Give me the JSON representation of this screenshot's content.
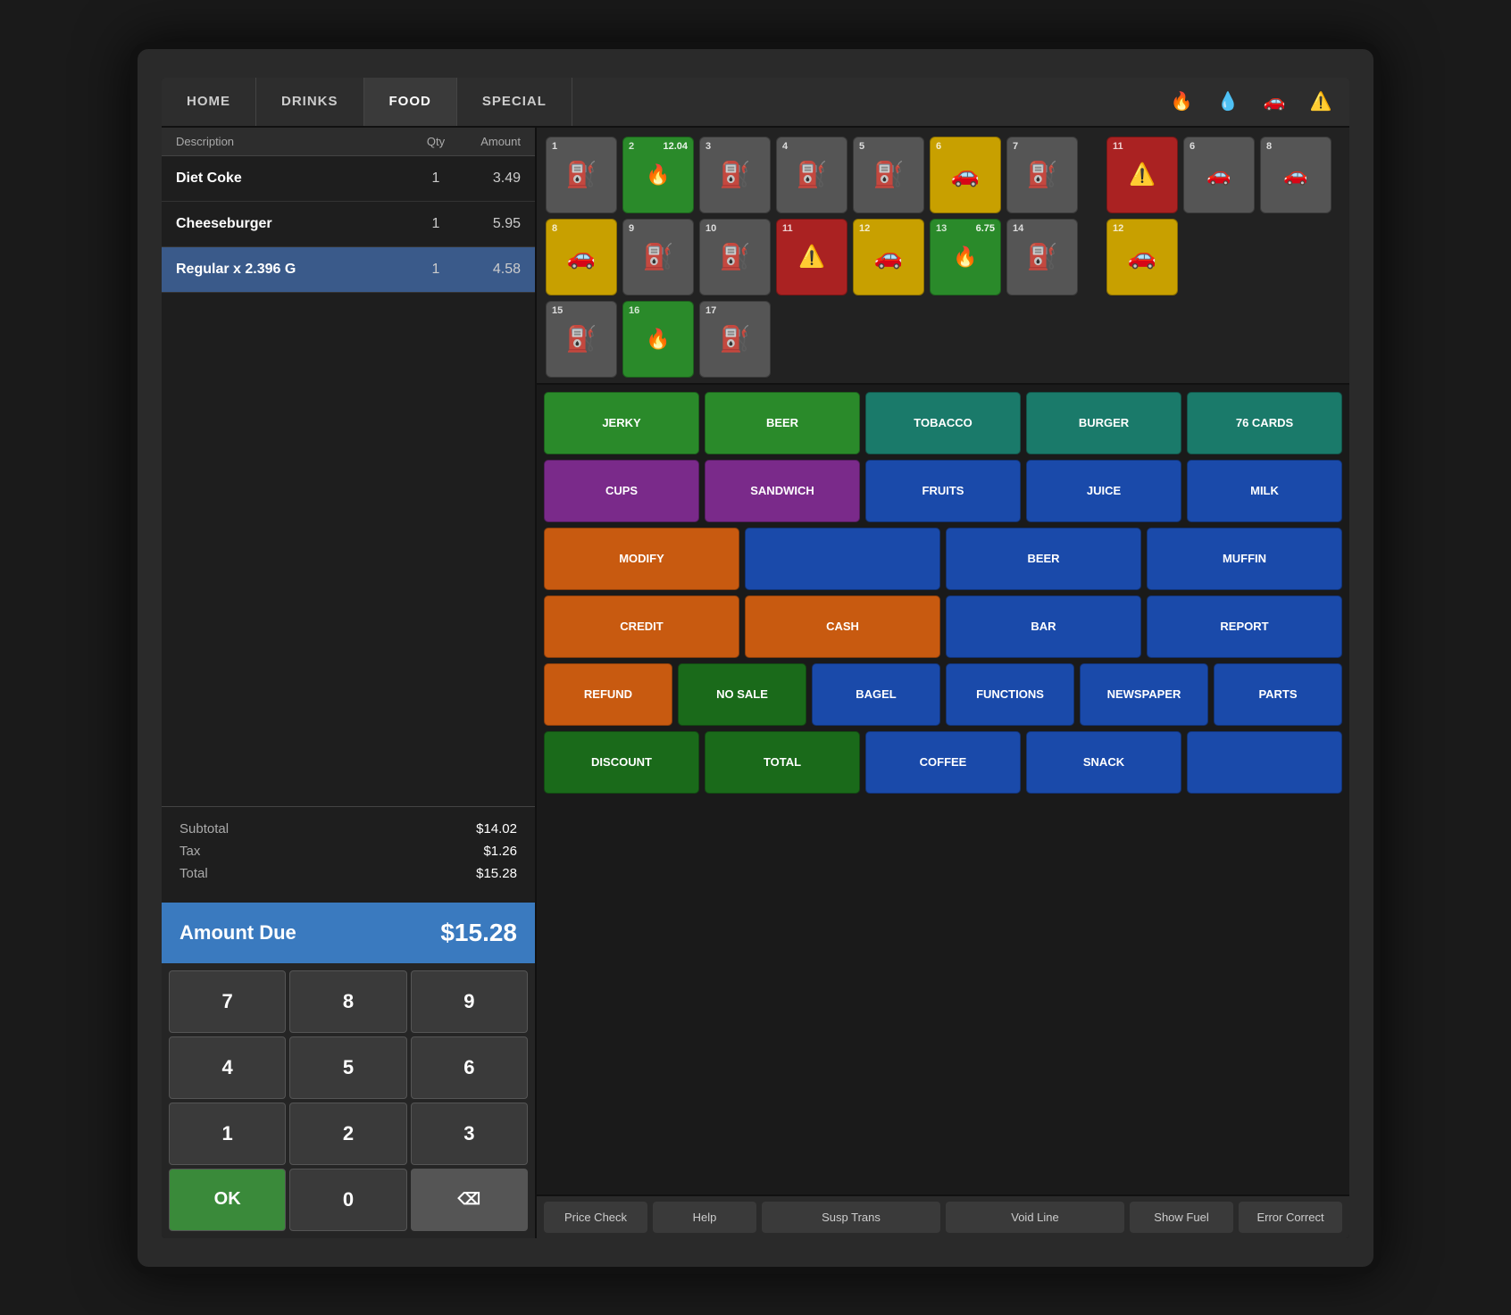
{
  "nav": {
    "tabs": [
      "HOME",
      "DRINKS",
      "FOOD",
      "SPECIAL"
    ],
    "active_tab": "HOME",
    "icons": [
      "🔥",
      "💧",
      "🚗",
      "⚠"
    ]
  },
  "order": {
    "header": {
      "description": "Description",
      "qty": "Qty",
      "amount": "Amount"
    },
    "rows": [
      {
        "description": "Diet Coke",
        "qty": "1",
        "amount": "3.49",
        "selected": false
      },
      {
        "description": "Cheeseburger",
        "qty": "1",
        "amount": "5.95",
        "selected": false
      },
      {
        "description": "Regular x 2.396 G",
        "qty": "1",
        "amount": "4.58",
        "selected": true
      }
    ],
    "subtotal_label": "Subtotal",
    "subtotal_value": "$14.02",
    "tax_label": "Tax",
    "tax_value": "$1.26",
    "total_label": "Total",
    "total_value": "$15.28",
    "amount_due_label": "Amount Due",
    "amount_due_value": "$15.28"
  },
  "numpad": {
    "keys": [
      "7",
      "8",
      "9",
      "4",
      "5",
      "6",
      "1",
      "2",
      "3",
      "0",
      "⌫",
      "OK"
    ]
  },
  "pumps": {
    "row1": [
      {
        "num": "1",
        "price": "",
        "color": "gray",
        "icon": "⛽",
        "type": "fuel"
      },
      {
        "num": "2",
        "price": "12.04",
        "color": "green",
        "icon": "🔥",
        "type": "active"
      },
      {
        "num": "3",
        "price": "",
        "color": "gray",
        "icon": "⛽",
        "type": "fuel"
      },
      {
        "num": "4",
        "price": "",
        "color": "gray",
        "icon": "⛽",
        "type": "fuel"
      },
      {
        "num": "5",
        "price": "",
        "color": "gray",
        "icon": "⛽",
        "type": "fuel"
      },
      {
        "num": "6",
        "price": "",
        "color": "yellow",
        "icon": "🚗",
        "type": "car"
      },
      {
        "num": "7",
        "price": "",
        "color": "gray",
        "icon": "⛽",
        "type": "fuel"
      }
    ],
    "row1_right": [
      {
        "num": "11",
        "price": "",
        "color": "red",
        "icon": "⚠",
        "type": "warn"
      },
      {
        "num": "6",
        "price": "",
        "color": "gray",
        "icon": "🚗",
        "type": "car"
      },
      {
        "num": "8",
        "price": "",
        "color": "gray",
        "icon": "🚗",
        "type": "car"
      }
    ],
    "row2": [
      {
        "num": "8",
        "price": "",
        "color": "yellow",
        "icon": "🚗",
        "type": "car"
      },
      {
        "num": "9",
        "price": "",
        "color": "gray",
        "icon": "⛽",
        "type": "fuel"
      },
      {
        "num": "10",
        "price": "",
        "color": "gray",
        "icon": "⛽",
        "type": "fuel"
      },
      {
        "num": "11",
        "price": "",
        "color": "red",
        "icon": "⚠",
        "type": "warn"
      },
      {
        "num": "12",
        "price": "",
        "color": "yellow",
        "icon": "🚗",
        "type": "car"
      },
      {
        "num": "13",
        "price": "6.75",
        "color": "green",
        "icon": "🔥",
        "type": "active"
      },
      {
        "num": "14",
        "price": "",
        "color": "gray",
        "icon": "⛽",
        "type": "fuel"
      }
    ],
    "row2_right": [
      {
        "num": "12",
        "price": "",
        "color": "yellow",
        "icon": "🚗",
        "type": "car"
      }
    ],
    "row3": [
      {
        "num": "15",
        "price": "",
        "color": "gray",
        "icon": "⛽",
        "type": "fuel"
      },
      {
        "num": "16",
        "price": "",
        "color": "green",
        "icon": "🔥",
        "type": "active"
      },
      {
        "num": "17",
        "price": "",
        "color": "gray",
        "icon": "⛽",
        "type": "fuel"
      }
    ]
  },
  "products": {
    "row1": [
      {
        "label": "JERKY",
        "color": "green"
      },
      {
        "label": "BEER",
        "color": "green"
      },
      {
        "label": "TOBACCO",
        "color": "teal"
      },
      {
        "label": "BURGER",
        "color": "teal"
      },
      {
        "label": "76 CARDS",
        "color": "teal"
      }
    ],
    "row2": [
      {
        "label": "CUPS",
        "color": "purple"
      },
      {
        "label": "SANDWICH",
        "color": "purple"
      },
      {
        "label": "FRUITS",
        "color": "blue"
      },
      {
        "label": "JUICE",
        "color": "blue"
      },
      {
        "label": "MILK",
        "color": "blue"
      }
    ],
    "row3": [
      {
        "label": "MODIFY",
        "color": "orange"
      },
      {
        "label": "",
        "color": "blue"
      },
      {
        "label": "BEER",
        "color": "blue"
      },
      {
        "label": "MUFFIN",
        "color": "blue"
      }
    ],
    "row4": [
      {
        "label": "CREDIT",
        "color": "orange"
      },
      {
        "label": "CASH",
        "color": "orange"
      },
      {
        "label": "BAR",
        "color": "blue"
      },
      {
        "label": "REPORT",
        "color": "blue"
      }
    ],
    "row5": [
      {
        "label": "REFUND",
        "color": "orange"
      },
      {
        "label": "NO SALE",
        "color": "dark-green"
      },
      {
        "label": "BAGEL",
        "color": "blue"
      },
      {
        "label": "FUNCTIONS",
        "color": "blue"
      },
      {
        "label": "NEWSPAPER",
        "color": "blue"
      },
      {
        "label": "PARTS",
        "color": "blue"
      }
    ],
    "row6": [
      {
        "label": "DISCOUNT",
        "color": "dark-green"
      },
      {
        "label": "TOTAL",
        "color": "dark-green"
      },
      {
        "label": "SNACK",
        "color": "blue"
      },
      {
        "label": "",
        "color": "blue"
      },
      {
        "label": "",
        "color": "blue"
      }
    ],
    "row7": [
      {
        "label": "COFFEE",
        "color": "blue"
      },
      {
        "label": "",
        "color": "blue"
      }
    ]
  },
  "bottom_actions": {
    "buttons": [
      "Price Check",
      "Help",
      "Susp Trans",
      "Void Line",
      "Show Fuel",
      "Error Correct"
    ]
  }
}
